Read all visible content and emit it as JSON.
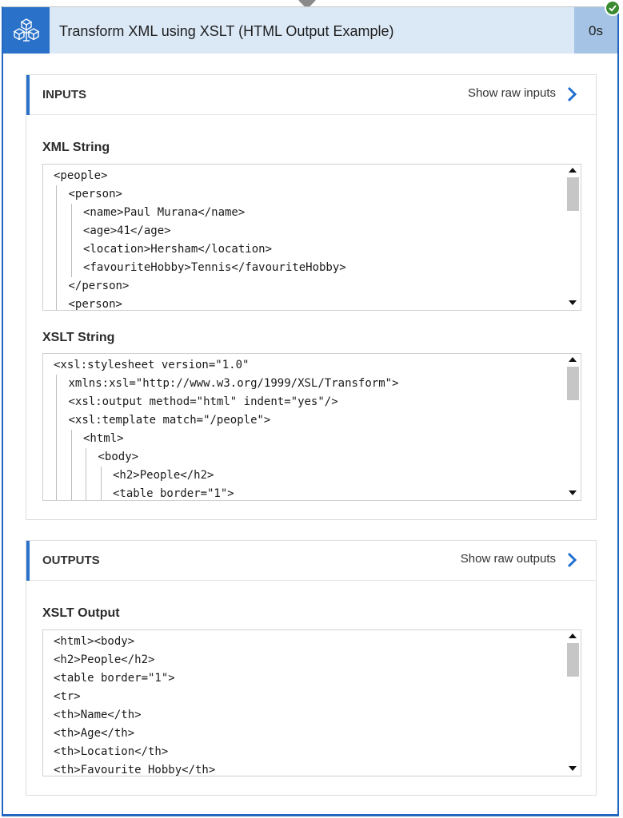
{
  "header": {
    "title": "Transform XML using XSLT (HTML Output Example)",
    "duration": "0s",
    "icon": "xml-transform-cubes-icon",
    "status_icon": "success-check-icon",
    "colors": {
      "accent": "#2a72c9",
      "header_bg": "#dbe8f6",
      "duration_bg": "#a4c3e5",
      "success": "#3a8a2f"
    }
  },
  "inputs": {
    "title": "INPUTS",
    "raw_link": "Show raw inputs",
    "xml_label": "XML String",
    "xml_lines": [
      "<people>",
      "<person>",
      "<name>Paul Murana</name>",
      "<age>41</age>",
      "<location>Hersham</location>",
      "<favouriteHobby>Tennis</favouriteHobby>",
      "</person>",
      "<person>"
    ],
    "xml_indent": [
      0,
      1,
      2,
      2,
      2,
      2,
      1,
      1
    ],
    "xslt_label": "XSLT String",
    "xslt_lines": [
      "<xsl:stylesheet version=\"1.0\"",
      "xmlns:xsl=\"http://www.w3.org/1999/XSL/Transform\">",
      "<xsl:output method=\"html\" indent=\"yes\"/>",
      "<xsl:template match=\"/people\">",
      "<html>",
      "<body>",
      "<h2>People</h2>",
      "<table border=\"1\">"
    ],
    "xslt_indent": [
      0,
      1,
      1,
      1,
      2,
      3,
      4,
      4
    ]
  },
  "outputs": {
    "title": "OUTPUTS",
    "raw_link": "Show raw outputs",
    "xslt_output_label": "XSLT Output",
    "output_lines": [
      "<html><body>",
      "<h2>People</h2>",
      "<table border=\"1\">",
      "<tr>",
      "<th>Name</th>",
      "<th>Age</th>",
      "<th>Location</th>",
      "<th>Favourite Hobby</th>"
    ],
    "output_indent": [
      0,
      0,
      0,
      0,
      0,
      0,
      0,
      0
    ]
  }
}
